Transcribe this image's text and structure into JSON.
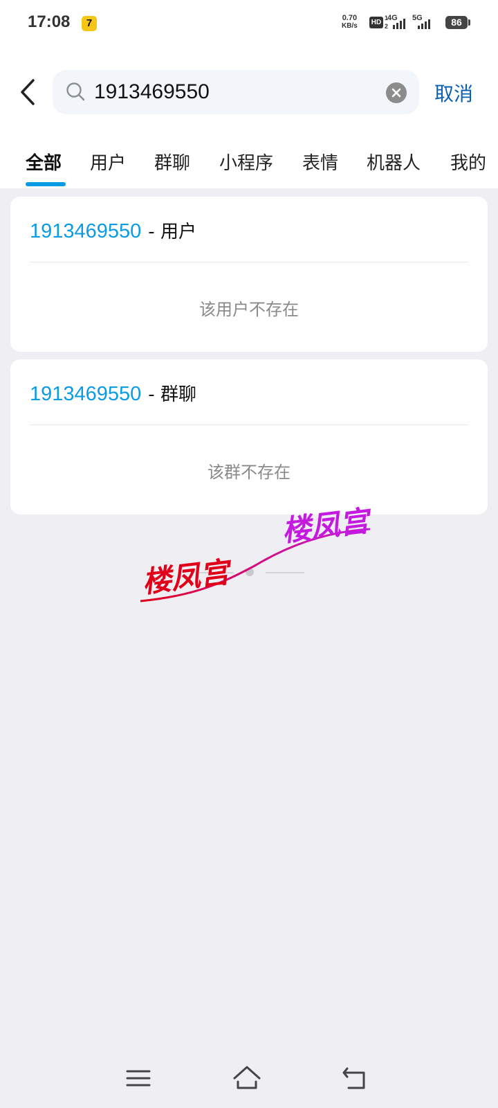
{
  "status_bar": {
    "time": "17:08",
    "app_icon_glyph": "7",
    "speed_value": "0.70",
    "speed_unit": "KB/s",
    "hd_label": "HD",
    "sim_top": "1",
    "sim_bottom": "2",
    "net_4g": "4G",
    "net_5g": "5G",
    "battery": "86"
  },
  "search": {
    "query": "1913469550",
    "cancel_label": "取消"
  },
  "tabs": [
    {
      "label": "全部",
      "active": true
    },
    {
      "label": "用户",
      "active": false
    },
    {
      "label": "群聊",
      "active": false
    },
    {
      "label": "小程序",
      "active": false
    },
    {
      "label": "表情",
      "active": false
    },
    {
      "label": "机器人",
      "active": false
    },
    {
      "label": "我的",
      "active": false
    }
  ],
  "results": [
    {
      "id": "1913469550",
      "type_label": "- 用户",
      "empty_text": "该用户不存在"
    },
    {
      "id": "1913469550",
      "type_label": "- 群聊",
      "empty_text": "该群不存在"
    }
  ],
  "watermark": {
    "text_red": "楼凤宫",
    "text_purple": "楼凤宫",
    "color_red": "#e0001a",
    "color_purple": "#c41ae0"
  },
  "colors": {
    "accent_blue": "#0a9be5",
    "cancel_blue": "#0a5fb2",
    "page_bg": "#efeff3"
  },
  "icons": {
    "back": "chevron-left-icon",
    "search": "magnifier-icon",
    "clear": "close-circle-icon",
    "nav_menu": "menu-icon",
    "nav_home": "home-icon",
    "nav_back": "back-arrow-icon"
  }
}
